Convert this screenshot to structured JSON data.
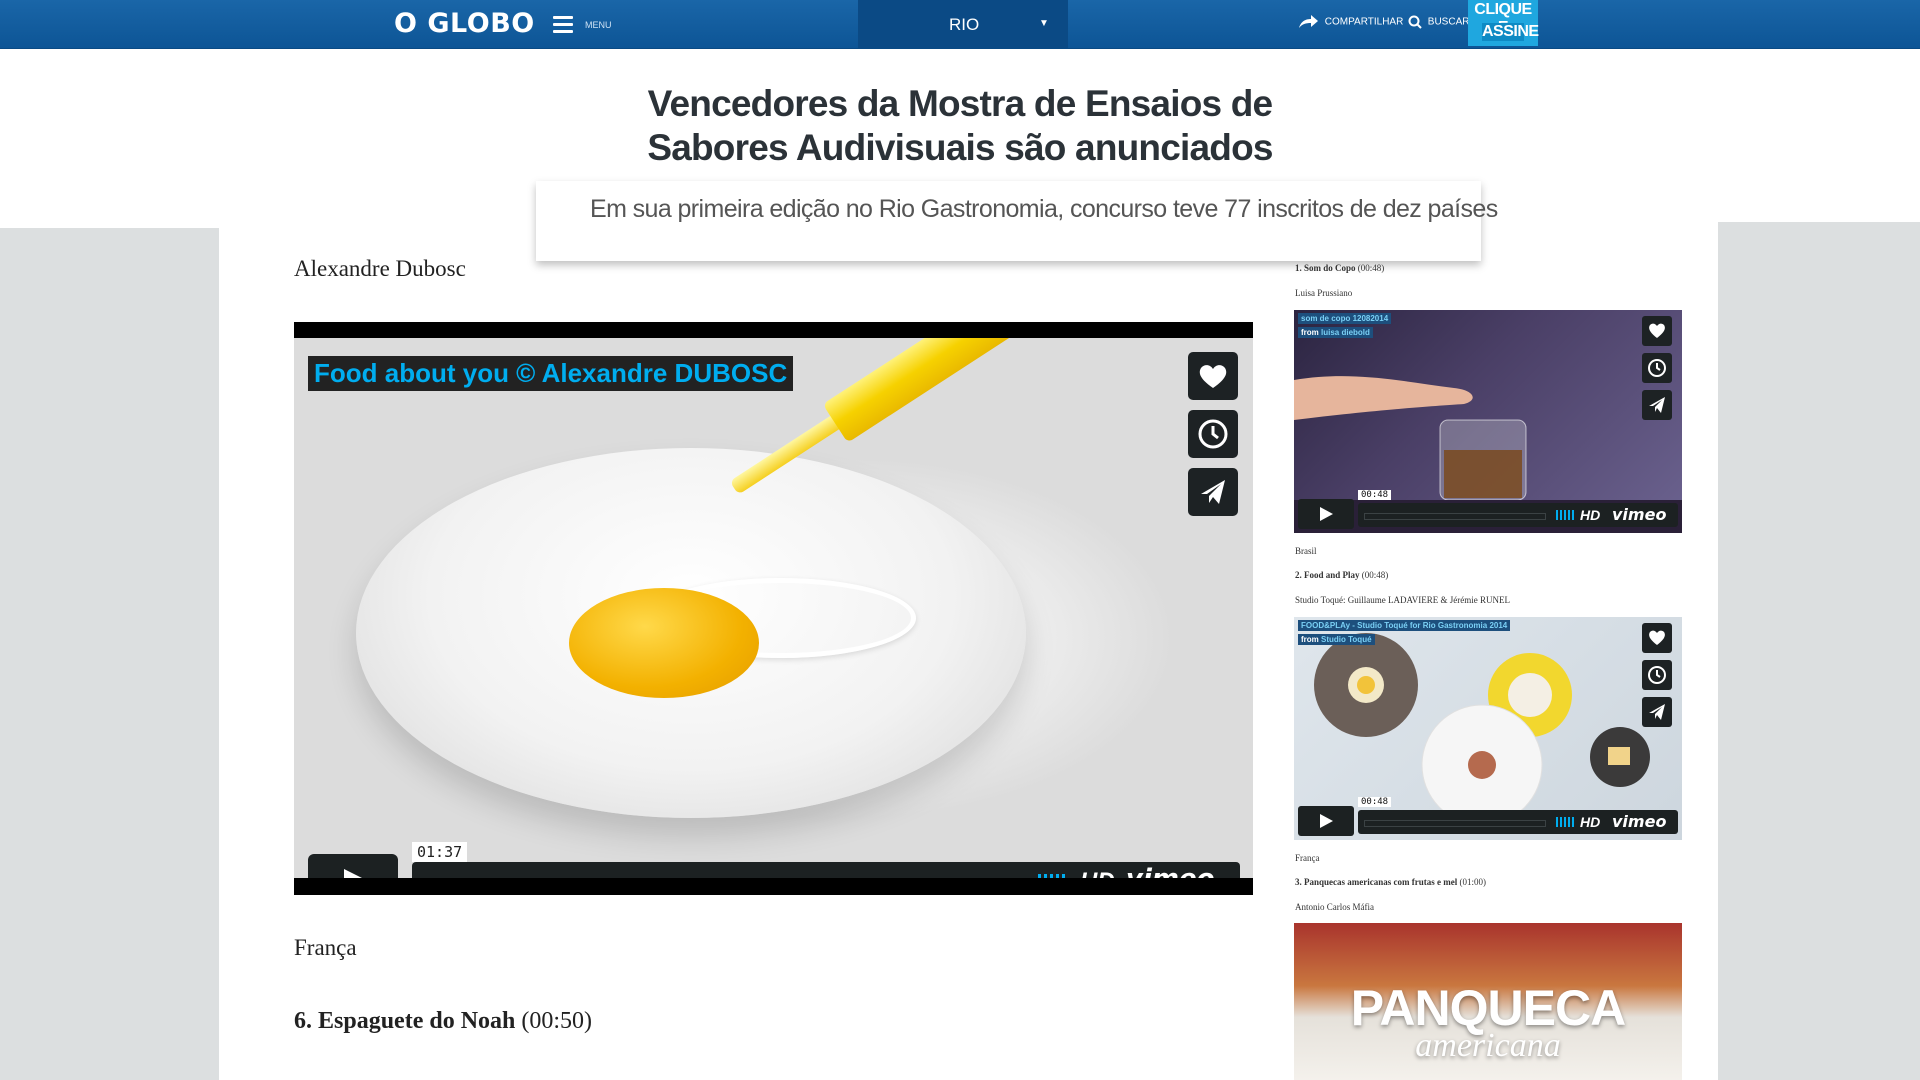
{
  "header": {
    "logo": "O GLOBO",
    "menu_label": "MENU",
    "region": "RIO",
    "share_label": "COMPARTILHAR",
    "search_label": "BUSCAR",
    "subscribe_line1": "CLIQUE E",
    "subscribe_line2": "ASSINE"
  },
  "article": {
    "title_line1": "Vencedores da Mostra de Ensaios de",
    "title_line2": "Sabores Audivisuais são anunciados",
    "subtitle": "Em sua primeira edição no Rio Gastronomia, concurso teve 77 inscritos de dez países",
    "author": "Alexandre Dubosc",
    "main_video": {
      "title": "Food about you © Alexandre DUBOSC",
      "time": "01:37",
      "hd": "HD",
      "brand": "vimeo"
    },
    "country": "França",
    "item6_title": "6. Espaguete do Noah",
    "item6_duration": "(00:50)"
  },
  "sidebar": {
    "entries": [
      {
        "heading": "1. Som do Copo",
        "duration": "(00:48)",
        "author": "Luisa Prussiano",
        "video_title": "som de copo 12082014",
        "from_prefix": "from",
        "from_name": "luisa diebold",
        "time": "00:48",
        "country": "Brasil"
      },
      {
        "heading": "2. Food and Play",
        "duration": "(00:48)",
        "author": "Studio Toqué: Guillaume LADAVIERE & Jérémie RUNEL",
        "video_title": "FOOD&PLAy - Studio Toqué for Rio Gastronomia 2014",
        "from_prefix": "from",
        "from_name": "Studio Toqué",
        "time": "00:48",
        "country": "França"
      },
      {
        "heading": "3. Panquecas americanas com frutas e mel",
        "duration": "(01:00)",
        "author": "Antonio Carlos Máfia",
        "thumb_title": "PANQUECA",
        "thumb_subtitle": "americana"
      }
    ],
    "hd": "HD",
    "brand": "vimeo"
  },
  "colors": {
    "header_blue": "#0d5596",
    "subscribe": "#1fa7df",
    "vimeo_blue": "#00adef"
  }
}
